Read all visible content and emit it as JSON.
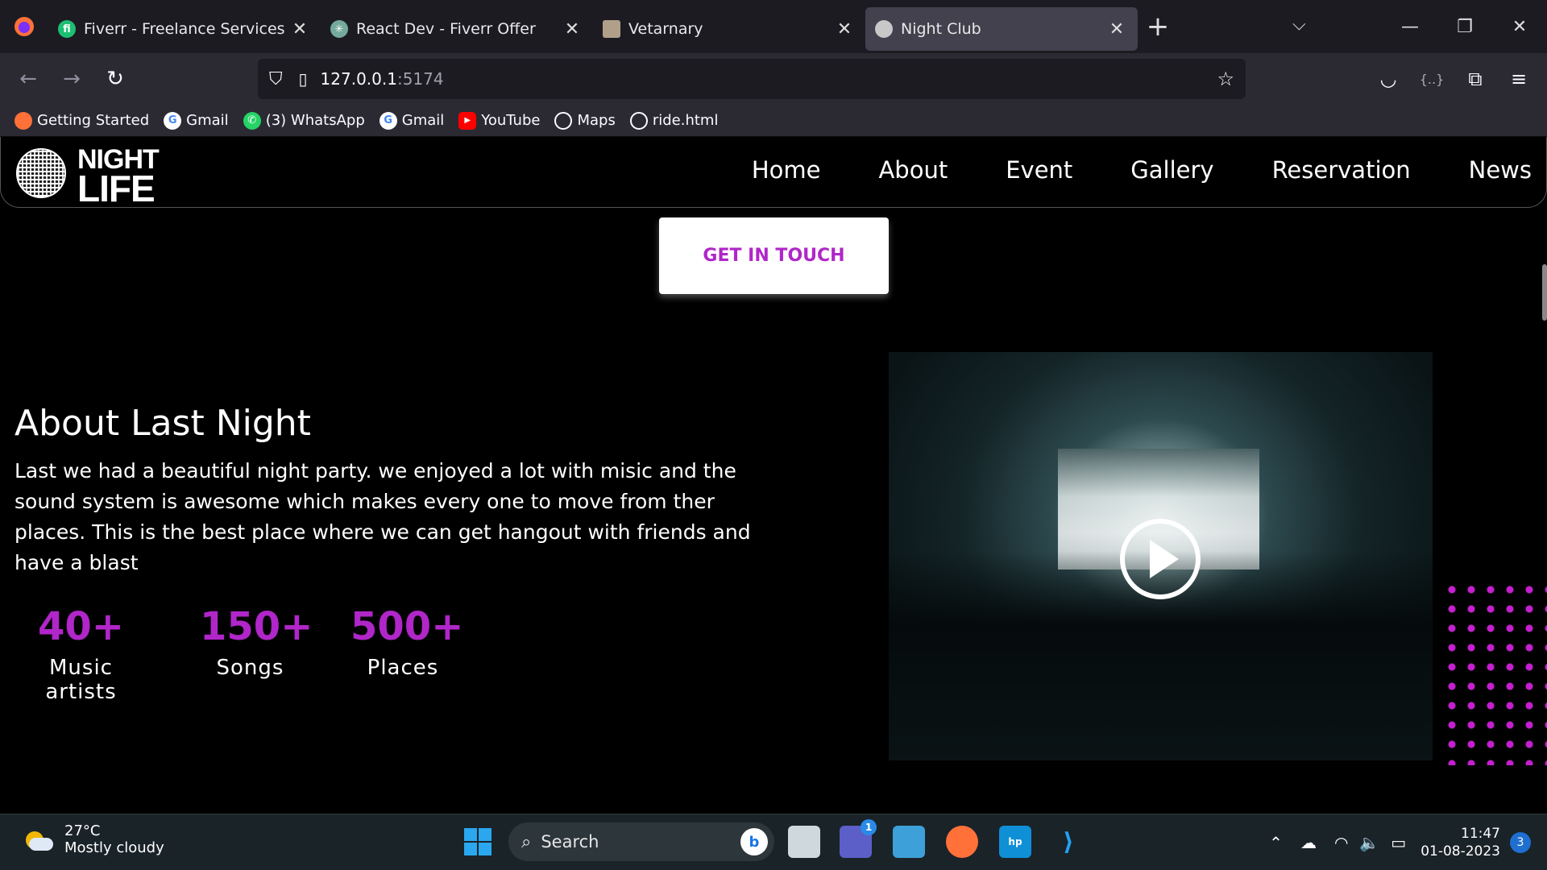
{
  "browser": {
    "tabs": [
      {
        "title": "Fiverr - Freelance Services Mark",
        "favicon_color": "#1dbf73",
        "favicon_letter": "fi"
      },
      {
        "title": "React Dev - Fiverr Offer",
        "favicon_color": "#74aa9c",
        "favicon_letter": "✳"
      },
      {
        "title": "Vetarnary",
        "favicon_color": "#b0a08a",
        "favicon_letter": ""
      },
      {
        "title": "Night Club",
        "favicon_color": "#c8c8c8",
        "favicon_letter": ""
      }
    ],
    "url_host": "127.0.0.1",
    "url_port": ":5174",
    "bookmarks": [
      {
        "label": "Getting Started",
        "icon": "firefox-icon",
        "color": "#ff7139"
      },
      {
        "label": "Gmail",
        "icon": "google-icon",
        "color": "#ffffff"
      },
      {
        "label": "(3) WhatsApp",
        "icon": "whatsapp-icon",
        "color": "#25d366"
      },
      {
        "label": "Gmail",
        "icon": "google-icon",
        "color": "#ffffff"
      },
      {
        "label": "YouTube",
        "icon": "youtube-icon",
        "color": "#ff0000"
      },
      {
        "label": "Maps",
        "icon": "globe-icon",
        "color": "#2b2a33"
      },
      {
        "label": "ride.html",
        "icon": "globe-icon",
        "color": "#2b2a33"
      }
    ]
  },
  "site": {
    "logo_line1": "NIGHT",
    "logo_line2": "LIFE",
    "menu": [
      "Home",
      "About",
      "Event",
      "Gallery",
      "Reservation",
      "News"
    ],
    "cta_label": "GET IN TOUCH",
    "about_title": "About Last Night",
    "about_text": "Last we had a beautiful night party. we enjoyed a lot with misic and the sound system is awesome which makes every one to move from ther places. This is the best place where we can get hangout with friends and have a blast",
    "stats": [
      {
        "num": "40+",
        "label": "Music artists"
      },
      {
        "num": "150+",
        "label": "Songs"
      },
      {
        "num": "500+",
        "label": "Places"
      }
    ],
    "accent": "#b026c9"
  },
  "taskbar": {
    "temp": "27°C",
    "weather": "Mostly cloudy",
    "search_placeholder": "Search",
    "time": "11:47",
    "date": "01-08-2023",
    "notifications": "3",
    "teams_badge": "1"
  }
}
